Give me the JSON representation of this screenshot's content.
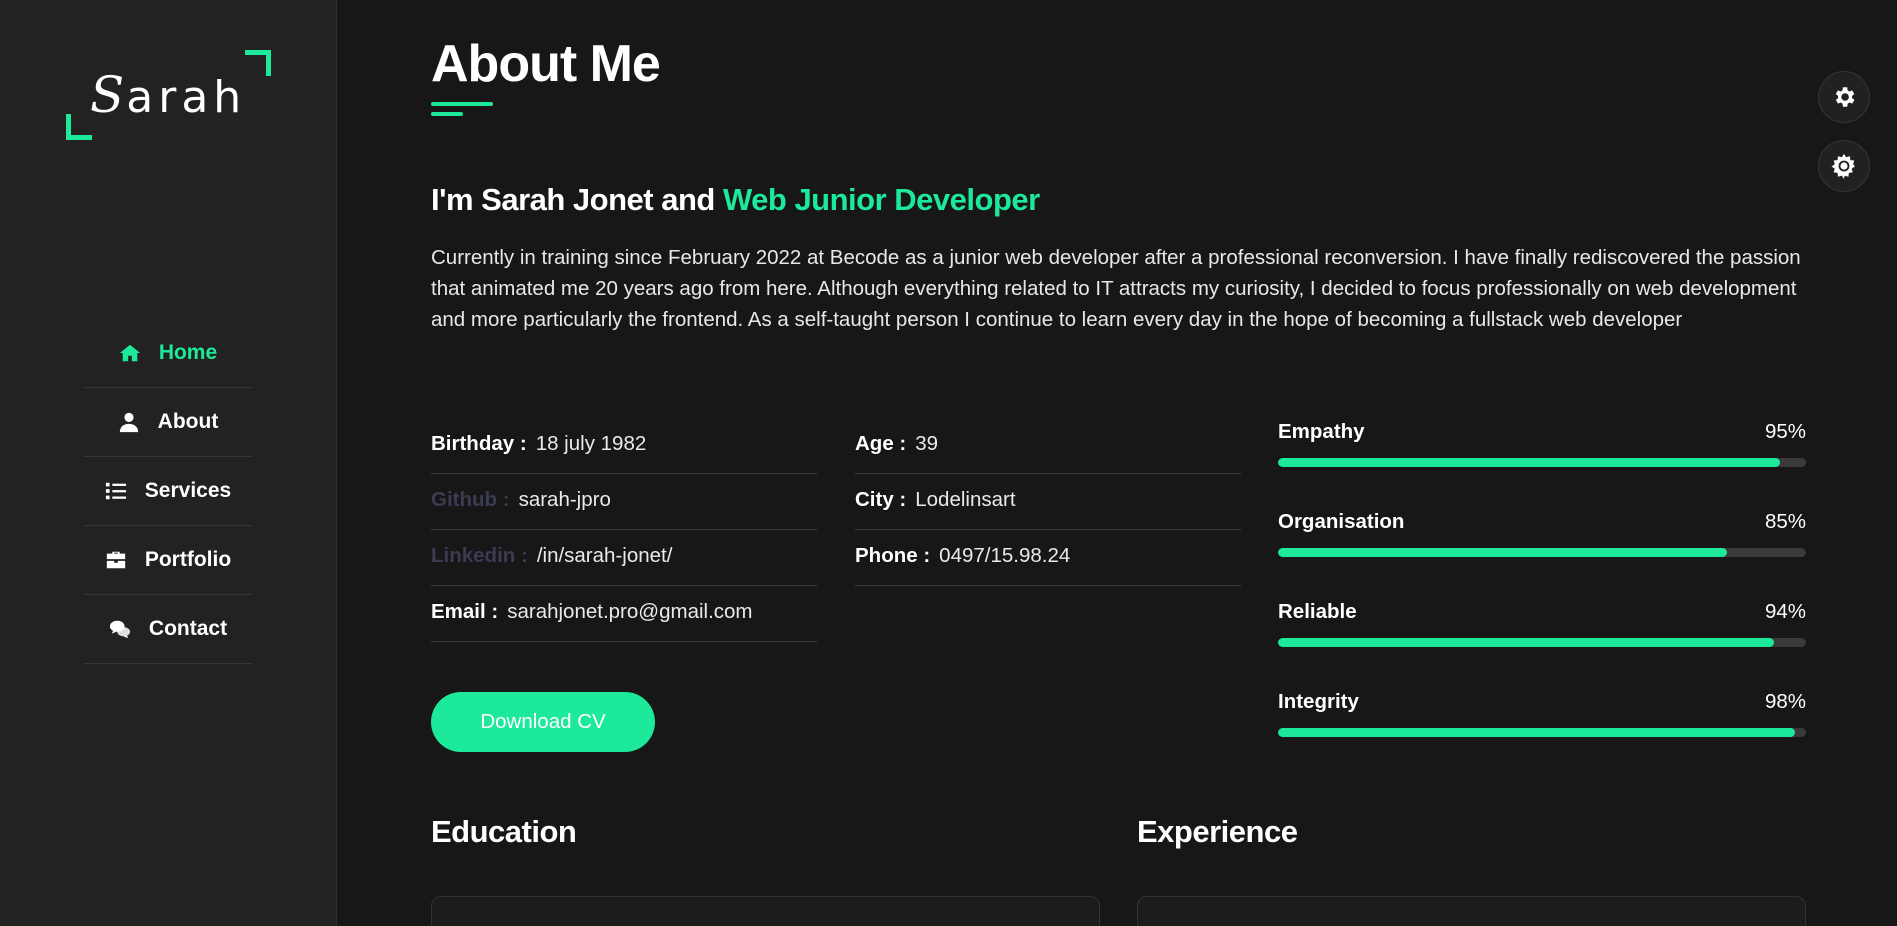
{
  "logo": {
    "initial": "S",
    "rest": "arah"
  },
  "colors": {
    "accent": "#1de99b",
    "background": "#171717",
    "sidebar": "#222222"
  },
  "nav": {
    "items": [
      {
        "label": "Home",
        "icon": "home-icon",
        "active": true
      },
      {
        "label": "About",
        "icon": "user-icon",
        "active": false
      },
      {
        "label": "Services",
        "icon": "list-icon",
        "active": false
      },
      {
        "label": "Portfolio",
        "icon": "briefcase-icon",
        "active": false
      },
      {
        "label": "Contact",
        "icon": "chat-icon",
        "active": false
      }
    ]
  },
  "main": {
    "title": "About Me",
    "headline_prefix": "I'm Sarah Jonet and ",
    "headline_accent": "Web Junior Developer",
    "bio": "Currently in training since February 2022 at Becode as a junior web developer after a professional reconversion. I have finally rediscovered the passion that animated me 20 years ago from here. Although everything related to IT attracts my curiosity, I decided to focus professionally on web development and more particularly the frontend. As a self-taught person I continue to learn every day in the hope of becoming a fullstack web developer",
    "info_left": [
      {
        "key": "Birthday :",
        "value": "18 july 1982"
      },
      {
        "key": "Github :",
        "value": "sarah-jpro"
      },
      {
        "key": "Linkedin :",
        "value": "/in/sarah-jonet/"
      },
      {
        "key": "Email :",
        "value": "sarahjonet.pro@gmail.com"
      }
    ],
    "info_right": [
      {
        "key": "Age :",
        "value": "39"
      },
      {
        "key": "City :",
        "value": "Lodelinsart"
      },
      {
        "key": "Phone :",
        "value": "0497/15.98.24"
      }
    ],
    "download_label": "Download CV",
    "skills": [
      {
        "name": "Empathy",
        "percent_label": "95%",
        "level": 0.95
      },
      {
        "name": "Organisation",
        "percent_label": "85%",
        "level": 0.85
      },
      {
        "name": "Reliable",
        "percent_label": "94%",
        "level": 0.94
      },
      {
        "name": "Integrity",
        "percent_label": "98%",
        "level": 0.98
      }
    ],
    "education_title": "Education",
    "experience_title": "Experience"
  },
  "floating": {
    "settings_icon": "gear-icon",
    "theme_icon": "sun-icon"
  }
}
